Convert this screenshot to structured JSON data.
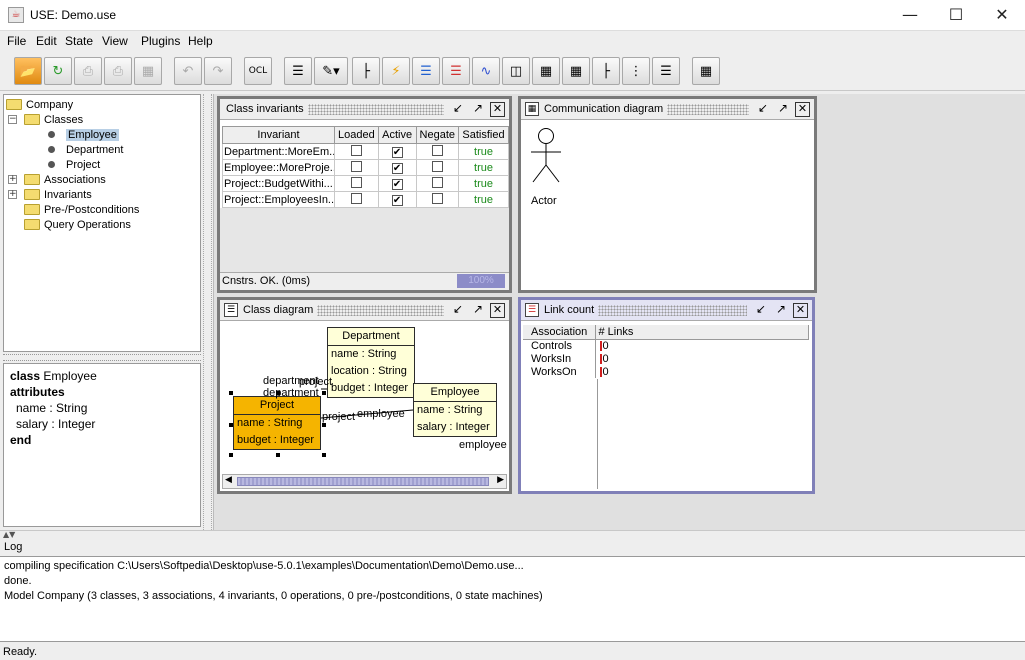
{
  "window": {
    "title": "USE: Demo.use"
  },
  "menu": [
    "File",
    "Edit",
    "State",
    "View",
    "Plugins",
    "Help"
  ],
  "toolbar": {
    "ocl_label": "OCL"
  },
  "tree": {
    "root": "Company",
    "classes_label": "Classes",
    "classes": [
      "Employee",
      "Department",
      "Project"
    ],
    "selected": "Employee",
    "associations": "Associations",
    "invariants": "Invariants",
    "prepost": "Pre-/Postconditions",
    "queries": "Query Operations"
  },
  "detail": {
    "kw_class": "class",
    "class_name": "Employee",
    "kw_attributes": "attributes",
    "attr1": "name : String",
    "attr2": "salary : Integer",
    "kw_end": "end"
  },
  "class_invariants": {
    "title": "Class invariants",
    "columns": [
      "Invariant",
      "Loaded",
      "Active",
      "Negate",
      "Satisfied"
    ],
    "rows": [
      {
        "invariant": "Department::MoreEm...",
        "loaded": false,
        "active": true,
        "negate": false,
        "satisfied": "true"
      },
      {
        "invariant": "Employee::MoreProje...",
        "loaded": false,
        "active": true,
        "negate": false,
        "satisfied": "true"
      },
      {
        "invariant": "Project::BudgetWithi...",
        "loaded": false,
        "active": true,
        "negate": false,
        "satisfied": "true"
      },
      {
        "invariant": "Project::EmployeesIn...",
        "loaded": false,
        "active": true,
        "negate": false,
        "satisfied": "true"
      }
    ],
    "status": "Cnstrs. OK. (0ms)",
    "progress": "100%"
  },
  "communication": {
    "title": "Communication diagram",
    "actor": "Actor"
  },
  "class_diagram": {
    "title": "Class diagram",
    "department": {
      "name": "Department",
      "attrs": [
        "name : String",
        "location : String",
        "budget : Integer"
      ]
    },
    "employee": {
      "name": "Employee",
      "attrs": [
        "name : String",
        "salary : Integer"
      ]
    },
    "project": {
      "name": "Project",
      "attrs": [
        "name : String",
        "budget : Integer"
      ]
    },
    "roles": {
      "department1": "department",
      "department2": "department",
      "project1": "project",
      "project2": "project",
      "employee1": "employee",
      "employee2": "employee"
    }
  },
  "link_count": {
    "title": "Link count",
    "columns": [
      "Association",
      "# Links"
    ],
    "rows": [
      {
        "assoc": "Controls",
        "links": "0"
      },
      {
        "assoc": "WorksIn",
        "links": "0"
      },
      {
        "assoc": "WorksOn",
        "links": "0"
      }
    ]
  },
  "log": {
    "label": "Log",
    "lines": [
      "compiling specification C:\\Users\\Softpedia\\Desktop\\use-5.0.1\\examples\\Documentation\\Demo\\Demo.use...",
      "done.",
      "Model Company (3 classes, 3 associations, 4 invariants, 0 operations, 0 pre-/postconditions, 0 state machines)"
    ]
  },
  "status": "Ready."
}
